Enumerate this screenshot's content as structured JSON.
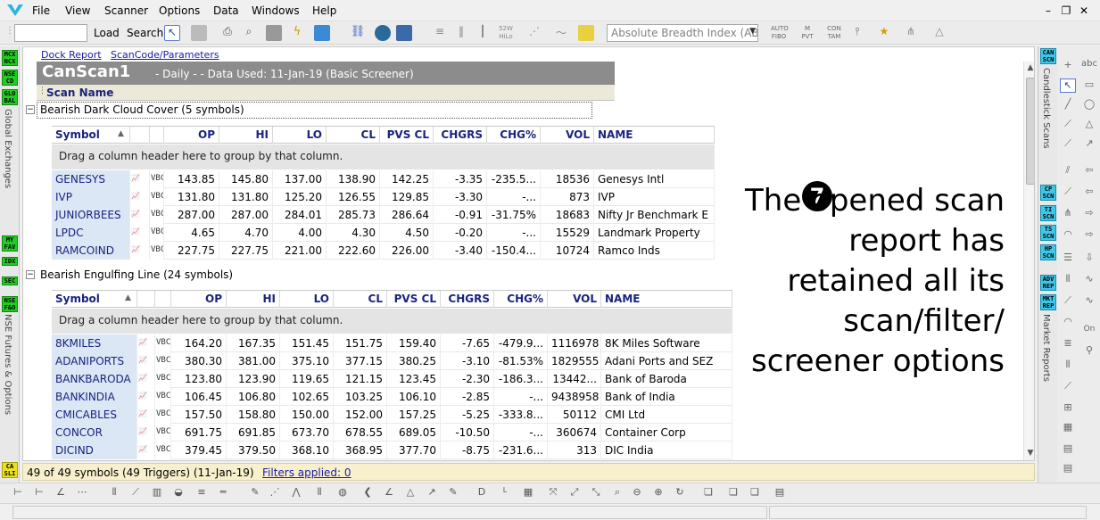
{
  "menu": [
    "File",
    "View",
    "Scanner",
    "Options",
    "Data",
    "Windows",
    "Help"
  ],
  "toolbar": {
    "symbol_value": "",
    "load_label": "Load",
    "search_label": "Search",
    "indicator_value": "Absolute Breadth Index (ABI",
    "mini_labels": [
      "52W HiLo",
      "AUTO FIBO",
      "M PVT",
      "CON TAM"
    ]
  },
  "left_sidebar": {
    "badges": [
      "MCX NCX",
      "NSE CD",
      "GLO BAL",
      "MY FAV",
      "IDX",
      "SEC",
      "NSE F&O",
      "CA SLI"
    ],
    "vertical_labels": [
      "Global Exchanges",
      "NSE Futures & Options"
    ]
  },
  "report": {
    "links": [
      "Dock Report",
      "ScanCode/Parameters"
    ],
    "scan_name": "CanScan1",
    "meta": "- Daily -   - Data Used:  11-Jan-19 (Basic Screener)",
    "scan_name_header": "Scan Name",
    "group_hint": "Drag a column header here to group by that column.",
    "columns": [
      "Symbol",
      "OP",
      "HI",
      "LO",
      "CL",
      "PVS CL",
      "CHGRS",
      "CHG%",
      "VOL",
      "NAME"
    ],
    "indicator_labels": [
      "VBC"
    ],
    "groups": [
      {
        "label": "Bearish Dark Cloud Cover (5 symbols)",
        "rows": [
          {
            "symbol": "GENESYS",
            "op": "143.85",
            "hi": "145.80",
            "lo": "137.00",
            "cl": "138.90",
            "pvs": "142.25",
            "chgrs": "-3.35",
            "chgp": "-235.5...",
            "vol": "18536",
            "name": "Genesys Intl"
          },
          {
            "symbol": "IVP",
            "op": "131.80",
            "hi": "131.80",
            "lo": "125.20",
            "cl": "126.55",
            "pvs": "129.85",
            "chgrs": "-3.30",
            "chgp": "-...",
            "vol": "873",
            "name": "IVP"
          },
          {
            "symbol": "JUNIORBEES",
            "op": "287.00",
            "hi": "287.00",
            "lo": "284.01",
            "cl": "285.73",
            "pvs": "286.64",
            "chgrs": "-0.91",
            "chgp": "-31.75%",
            "vol": "18683",
            "name": "Nifty Jr Benchmark E"
          },
          {
            "symbol": "LPDC",
            "op": "4.65",
            "hi": "4.70",
            "lo": "4.00",
            "cl": "4.30",
            "pvs": "4.50",
            "chgrs": "-0.20",
            "chgp": "-...",
            "vol": "15529",
            "name": "Landmark Property"
          },
          {
            "symbol": "RAMCOIND",
            "op": "227.75",
            "hi": "227.75",
            "lo": "221.00",
            "cl": "222.60",
            "pvs": "226.00",
            "chgrs": "-3.40",
            "chgp": "-150.4...",
            "vol": "10724",
            "name": "Ramco Inds"
          }
        ]
      },
      {
        "label": "Bearish Engulfing Line (24 symbols)",
        "rows": [
          {
            "symbol": "8KMILES",
            "op": "164.20",
            "hi": "167.35",
            "lo": "151.45",
            "cl": "151.75",
            "pvs": "159.40",
            "chgrs": "-7.65",
            "chgp": "-479.9...",
            "vol": "1116978",
            "name": "8K Miles Software"
          },
          {
            "symbol": "ADANIPORTS",
            "op": "380.30",
            "hi": "381.00",
            "lo": "375.10",
            "cl": "377.15",
            "pvs": "380.25",
            "chgrs": "-3.10",
            "chgp": "-81.53%",
            "vol": "1829555",
            "name": "Adani Ports and SEZ"
          },
          {
            "symbol": "BANKBARODA",
            "op": "123.80",
            "hi": "123.90",
            "lo": "119.65",
            "cl": "121.15",
            "pvs": "123.45",
            "chgrs": "-2.30",
            "chgp": "-186.3...",
            "vol": "13442...",
            "name": "Bank of Baroda"
          },
          {
            "symbol": "BANKINDIA",
            "op": "106.45",
            "hi": "106.80",
            "lo": "102.65",
            "cl": "103.25",
            "pvs": "106.10",
            "chgrs": "-2.85",
            "chgp": "-...",
            "vol": "9438958",
            "name": "Bank of India"
          },
          {
            "symbol": "CMICABLES",
            "op": "157.50",
            "hi": "158.80",
            "lo": "150.00",
            "cl": "152.00",
            "pvs": "157.25",
            "chgrs": "-5.25",
            "chgp": "-333.8...",
            "vol": "50112",
            "name": "CMI Ltd"
          },
          {
            "symbol": "CONCOR",
            "op": "691.75",
            "hi": "691.85",
            "lo": "673.70",
            "cl": "678.55",
            "pvs": "689.05",
            "chgrs": "-10.50",
            "chgp": "-...",
            "vol": "360674",
            "name": "Container Corp"
          },
          {
            "symbol": "DICIND",
            "op": "379.45",
            "hi": "379.50",
            "lo": "368.10",
            "cl": "368.95",
            "pvs": "377.70",
            "chgrs": "-8.75",
            "chgp": "-231.6...",
            "vol": "313",
            "name": "DIC India"
          }
        ]
      }
    ]
  },
  "annotation": {
    "step": "7",
    "text": "The opened scan report has retained all its scan/filter/ screener options"
  },
  "status": {
    "text": "49 of 49 symbols (49 Triggers) (11-Jan-19)",
    "filters": "Filters applied: 0"
  },
  "right_sidebar": {
    "badges_top": [
      "CAN SCN"
    ],
    "badges_mid": [
      "CP SCN",
      "TI SCN",
      "TS SCN",
      "HP SCN",
      "ADV REP",
      "MKT REP"
    ],
    "vertical_labels": [
      "Candlestick Scans",
      "Market Reports"
    ],
    "tool_labels": [
      "abc",
      "On"
    ]
  },
  "colors": {
    "title_bg": "#8c8c8c",
    "symbol_bg": "#dbe7f5",
    "header_text": "#1a237e",
    "status_bg": "#f8f0cc",
    "left_badge": "#22cc22",
    "right_badge": "#3ec7e8"
  }
}
